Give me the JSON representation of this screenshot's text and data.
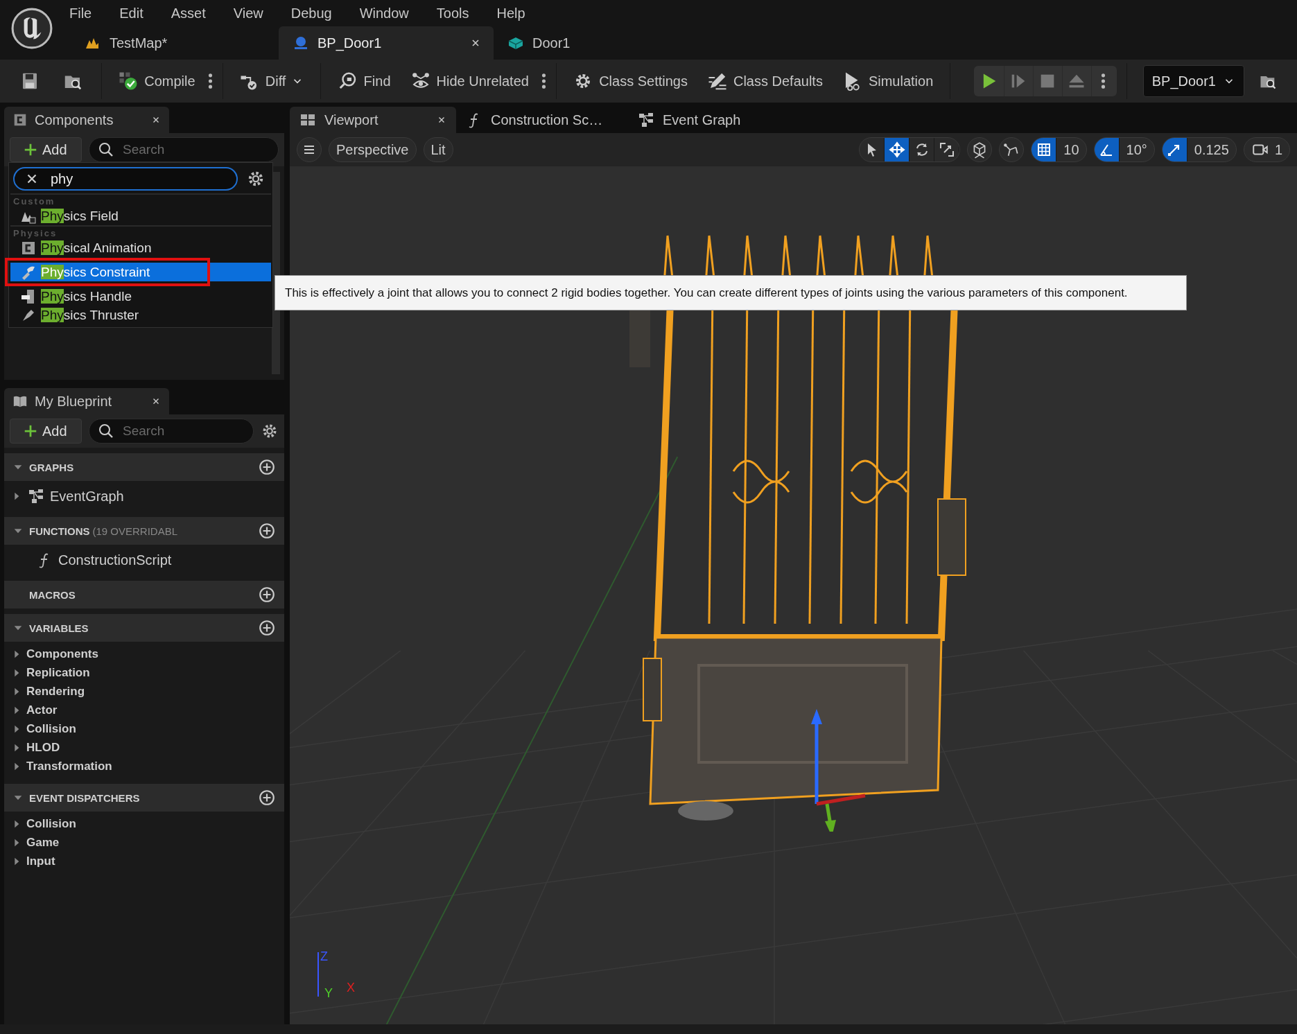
{
  "menu": [
    "File",
    "Edit",
    "Asset",
    "View",
    "Debug",
    "Window",
    "Tools",
    "Help"
  ],
  "document_tabs": [
    {
      "label": "TestMap*",
      "selected": false
    },
    {
      "label": "BP_Door1",
      "selected": true
    },
    {
      "label": "Door1",
      "selected": false
    }
  ],
  "toolbar": [
    "Compile",
    "Diff",
    "Find",
    "Hide Unrelated",
    "Class Settings",
    "Class Defaults",
    "Simulation"
  ],
  "debug_object": {
    "value": "BP_Door1"
  },
  "components": {
    "tab": "Components",
    "add_label": "Add",
    "search_placeholder": "Search",
    "picker": {
      "query": "phy",
      "groups": [
        {
          "name": "Custom",
          "items": [
            {
              "match": "Phy",
              "rest": "sics Field",
              "selected": false
            }
          ]
        },
        {
          "name": "Physics",
          "items": [
            {
              "match": "Phy",
              "rest": "sical Animation",
              "selected": false
            },
            {
              "match": "Phy",
              "rest": "sics Constraint",
              "selected": true,
              "annotated": true
            },
            {
              "match": "Phy",
              "rest": "sics Handle",
              "selected": false
            },
            {
              "match": "Phy",
              "rest": "sics Thruster",
              "selected": false
            }
          ]
        }
      ]
    },
    "tooltip": "This is effectively a joint that allows you to connect 2 rigid bodies together. You can create different types of joints using the various parameters of this component."
  },
  "my_blueprint": {
    "tab": "My Blueprint",
    "add_label": "Add",
    "search_placeholder": "Search",
    "sections": [
      {
        "title": "GRAPHS",
        "expanded": true,
        "items": [
          {
            "label": "EventGraph",
            "kind": "graph"
          }
        ]
      },
      {
        "title": "FUNCTIONS",
        "note": "(19 OVERRIDABL",
        "expanded": true,
        "items": [
          {
            "label": "ConstructionScript",
            "kind": "function"
          }
        ]
      },
      {
        "title": "MACROS"
      },
      {
        "title": "VARIABLES",
        "expanded": true,
        "items": [
          {
            "label": "Components",
            "kind": "category"
          },
          {
            "label": "Replication",
            "kind": "category"
          },
          {
            "label": "Rendering",
            "kind": "category"
          },
          {
            "label": "Actor",
            "kind": "category"
          },
          {
            "label": "Collision",
            "kind": "category"
          },
          {
            "label": "HLOD",
            "kind": "category"
          },
          {
            "label": "Transformation",
            "kind": "category"
          }
        ]
      },
      {
        "title": "EVENT DISPATCHERS",
        "expanded": true,
        "items": [
          {
            "label": "Collision",
            "kind": "category"
          },
          {
            "label": "Game",
            "kind": "category"
          },
          {
            "label": "Input",
            "kind": "category"
          }
        ]
      }
    ]
  },
  "editor_tabs": [
    {
      "label": "Viewport",
      "selected": true
    },
    {
      "label": "Construction Sc…",
      "selected": false
    },
    {
      "label": "Event Graph",
      "selected": false
    }
  ],
  "viewport": {
    "view_buttons": [
      "Perspective",
      "Lit"
    ],
    "transform_tools": [
      {
        "selected": false
      },
      {
        "selected": true
      },
      {
        "selected": false
      },
      {
        "selected": false
      }
    ],
    "snaps": [
      {
        "value": "10",
        "on": true
      },
      {
        "value": "10°",
        "on": true
      },
      {
        "value": "0.125",
        "on": true
      }
    ],
    "camera_speed": "1",
    "axes": [
      {
        "label": "Z",
        "color": "#3a55ff"
      },
      {
        "label": "Y",
        "color": "#4fd02a"
      },
      {
        "label": "X",
        "color": "#e02020"
      }
    ]
  }
}
